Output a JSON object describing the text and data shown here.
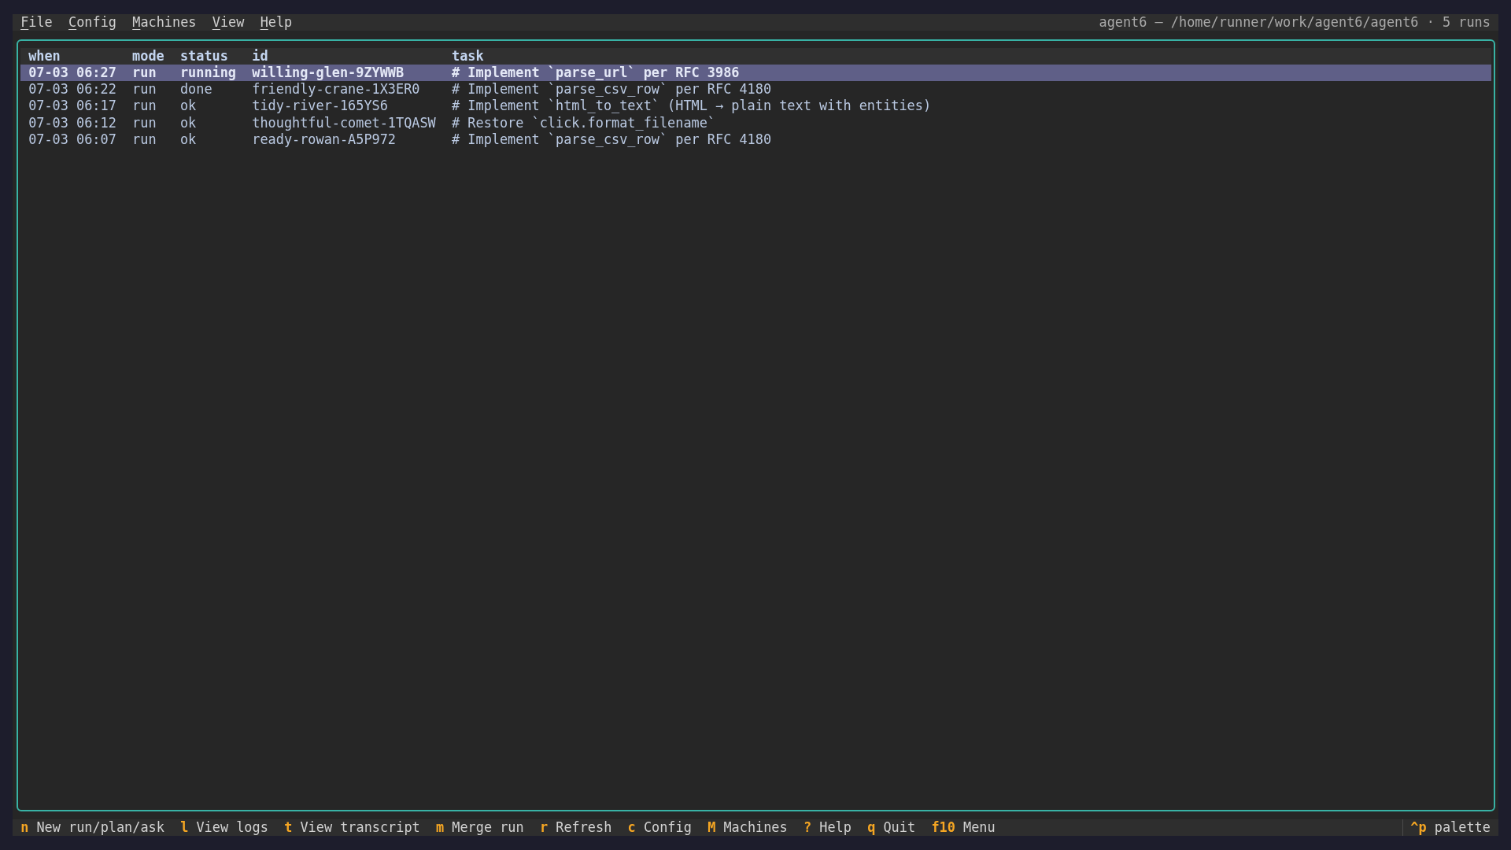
{
  "menu_bar": {
    "menus": [
      {
        "label": "File",
        "mnemonic_underlined": true
      },
      {
        "label": "Config",
        "mnemonic_underlined": true
      },
      {
        "label": "Machines",
        "mnemonic_underlined": true
      },
      {
        "label": "View",
        "mnemonic_underlined": true
      },
      {
        "label": "Help",
        "mnemonic_underlined": true
      }
    ],
    "title": "agent6 — /home/runner/work/agent6/agent6 · 5 runs"
  },
  "runs_table": {
    "columns": [
      "when",
      "mode",
      "status",
      "id",
      "task"
    ],
    "rows": [
      {
        "cells": [
          "07-03 06:27",
          "run",
          "running",
          "willing-glen-9ZYWWB",
          "# Implement `parse_url` per RFC 3986"
        ],
        "selected": true
      },
      {
        "cells": [
          "07-03 06:22",
          "run",
          "done",
          "friendly-crane-1X3ER0",
          "# Implement `parse_csv_row` per RFC 4180"
        ],
        "selected": false
      },
      {
        "cells": [
          "07-03 06:17",
          "run",
          "ok",
          "tidy-river-165YS6",
          "# Implement `html_to_text` (HTML → plain text with entities)"
        ],
        "selected": false
      },
      {
        "cells": [
          "07-03 06:12",
          "run",
          "ok",
          "thoughtful-comet-1TQASW",
          "# Restore `click.format_filename`"
        ],
        "selected": false
      },
      {
        "cells": [
          "07-03 06:07",
          "run",
          "ok",
          "ready-rowan-A5P972",
          "# Implement `parse_csv_row` per RFC 4180"
        ],
        "selected": false
      }
    ]
  },
  "key_bar": {
    "shortcuts": [
      {
        "key": "n",
        "label": "New run/plan/ask"
      },
      {
        "key": "l",
        "label": "View logs"
      },
      {
        "key": "t",
        "label": "View transcript"
      },
      {
        "key": "m",
        "label": "Merge run"
      },
      {
        "key": "r",
        "label": "Refresh"
      },
      {
        "key": "c",
        "label": "Config"
      },
      {
        "key": "M",
        "label": "Machines"
      },
      {
        "key": "?",
        "label": "Help"
      },
      {
        "key": "q",
        "label": "Quit"
      },
      {
        "key": "f10",
        "label": "Menu"
      }
    ],
    "palette": {
      "key": "^p",
      "label": "palette"
    }
  }
}
